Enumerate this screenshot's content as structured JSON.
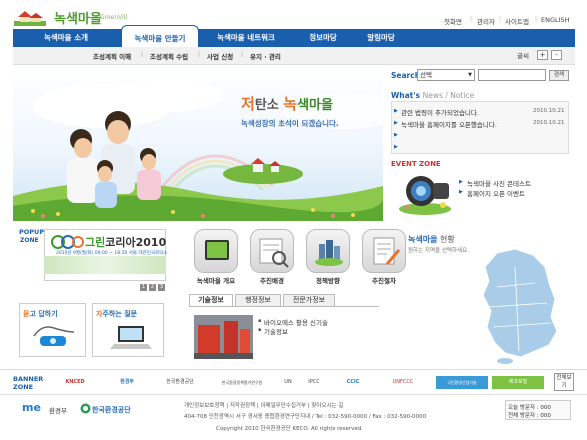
{
  "site": {
    "logo_text": "녹색마을",
    "logo_sub": "GreenVill"
  },
  "top_links": [
    "첫화면",
    "관리자",
    "사이트맵",
    "ENGLISH"
  ],
  "gnb": {
    "items": [
      "녹색마을 소개",
      "녹색마을 만들기",
      "녹색마을 네트워크",
      "정보마당",
      "알림마당"
    ],
    "active": "녹색마을 만들기"
  },
  "subnav": {
    "items": [
      "조성계획 이해",
      "조성계획 수립",
      "사업 신청",
      "유지 · 관리"
    ],
    "font_label": "글씨",
    "font_plus": "+",
    "font_minus": "-"
  },
  "hero": {
    "title_a": "저",
    "title_b": "탄소 ",
    "title_c": "녹색마을",
    "subtitle": "녹색성장의 초석이 되겠습니다."
  },
  "search": {
    "label": "Search",
    "select_value": "선택",
    "button": "검색"
  },
  "news": {
    "heading": "What's",
    "heading_sub": "News / Notice",
    "items": [
      {
        "title": "관련 법령이 추가되었습니다.",
        "date": "2010.10.21"
      },
      {
        "title": "녹색마을 홈페이지를 오픈했습니다.",
        "date": "2010.10.21"
      }
    ]
  },
  "event": {
    "heading": "EVENT ZONE",
    "items": [
      "녹색마을 사진 콘테스트",
      "홈페이지 오픈 이벤트"
    ]
  },
  "popup": {
    "heading": "POPUP",
    "heading2": "ZONE",
    "logo_a": "그린",
    "logo_b": "코리아2010",
    "desc": "2010년 9월(월/화) 09:00 ~ 18:30 서울 대한민국회의소",
    "pager": [
      "1",
      "2",
      "3"
    ]
  },
  "qna": {
    "title_a": "묻",
    "title_b": "고 답하기"
  },
  "faq": {
    "title_a": "자",
    "title_b": "주하는 질문"
  },
  "quick": {
    "items": [
      "녹색마을 개요",
      "추진배경",
      "정책방향",
      "추진절차"
    ]
  },
  "tabs": {
    "items": [
      "기술정보",
      "행정정보",
      "전문가정보"
    ],
    "active": "기술정보",
    "list": [
      "바이오에스 활용 신기술",
      "기술정보"
    ]
  },
  "map": {
    "title_a": "녹색마을",
    "title_b": " 현황",
    "sub": "원하는 지역을 선택하세요."
  },
  "banner": {
    "heading": "BANNER",
    "heading2": "ZONE",
    "items": [
      "KNCED",
      "환경부",
      "한국환경공단",
      "한국환경정책평가연구원",
      "UN",
      "IPCC",
      "CCIC",
      "UNFCCC",
      "국민환경산업기술",
      "에코포털"
    ],
    "view_all": "전체보기"
  },
  "footer": {
    "logo1": "me",
    "logo1b": "환경부",
    "logo2": "한국환경공단",
    "links": "개인정보보호정책  |  저작권정책  |  이메일무단수집거부  |  찾아오시는 길",
    "address": "404-708 인천광역시 서구 경서동 종합환경연구단지내 / Tel : 032-590-0000 / Fax : 032-590-0000",
    "copyright": "Copyright 2010 한국환경공단 KECO. All rights reserved.",
    "visit_today": "오늘 방문자 : 000",
    "visit_total": "전체 방문자 : 000"
  },
  "colors": {
    "brand_blue": "#1a5fad",
    "brand_green": "#4c9b2c",
    "hero_orange": "#e8742a"
  }
}
